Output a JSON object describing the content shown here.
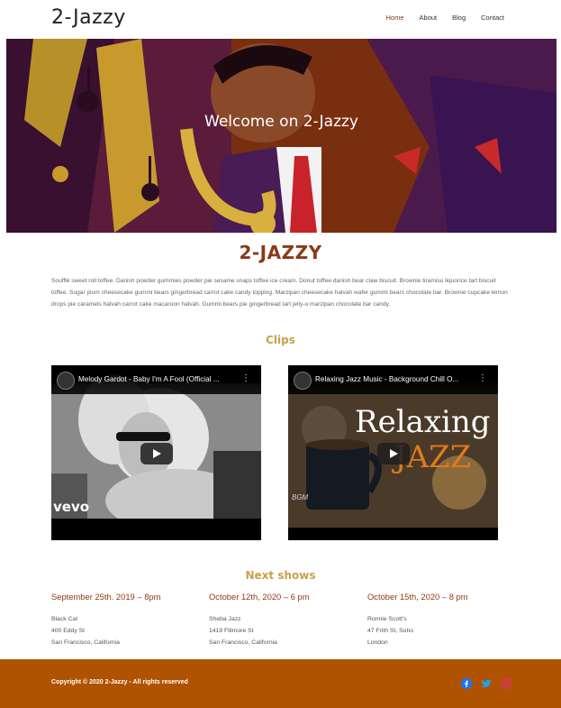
{
  "header": {
    "logo": "2-Jazzy",
    "nav": [
      "Home",
      "About",
      "Blog",
      "Contact"
    ]
  },
  "hero": {
    "title": "Welcome on 2-Jazzy"
  },
  "main": {
    "title": "2-JAZZY",
    "intro": "Soufflé sweet roll toffee. Danish powder gummies powder pie sesame snaps toffee ice cream. Donut toffee danish bear claw biscuit. Brownie tiramisu liquorice tart biscuit toffee. Sugar plum cheesecake gummi bears gingerbread carrot cake candy topping. Marzipan cheesecake halvah wafer gummi bears chocolate bar. Brownie cupcake lemon drops pie caramels halvah carrot cake macaroon halvah. Gummi bears pie gingerbread tart jelly-o marzipan chocolate bar candy."
  },
  "clips": {
    "title": "Clips",
    "videos": [
      {
        "title": "Melody Gardot - Baby I'm A Fool (Official ...",
        "watermark": "vevo"
      },
      {
        "title": "Relaxing Jazz Music - Background Chill O...",
        "thumb_text_1": "Relaxing",
        "thumb_text_2": "JAZZ",
        "badge": "BGM"
      }
    ]
  },
  "shows": {
    "title": "Next shows",
    "items": [
      {
        "date": "September 25th. 2019 – 8pm",
        "venue": "Black Cat",
        "street": "400 Eddy St",
        "city": "San Francisco, California"
      },
      {
        "date": "October 12th, 2020 – 6 pm",
        "venue": "Sheba Jazz",
        "street": "1419 Fillmore St",
        "city": "San Francisco, California"
      },
      {
        "date": "October 15th, 2020 – 8 pm",
        "venue": "Ronnie Scott's",
        "street": "47 Frith St, Soho",
        "city": "London"
      }
    ]
  },
  "footer": {
    "copyright": "Copyright © 2020 2-Jazzy - All rights reserved",
    "social": [
      "facebook-icon",
      "twitter-icon",
      "instagram-icon"
    ]
  },
  "colors": {
    "accent": "#8a3a16",
    "gold": "#c8a14b",
    "footer": "#b05300"
  }
}
